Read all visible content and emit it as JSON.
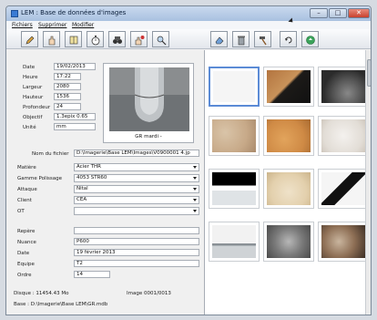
{
  "window": {
    "title": "LEM : Base de données d'images"
  },
  "menu": [
    "Fichiers",
    "Supprimer",
    "Modifier"
  ],
  "toolbar": {
    "left_icons": [
      "pencil-icon",
      "hand-icon",
      "book-icon",
      "stopwatch-icon",
      "binoculars-icon",
      "add-hand-icon",
      "hand-lens-icon"
    ],
    "right_icons": [
      "eraser-icon",
      "trash-icon",
      "hammer-icon",
      "rotate-icon",
      "recycle-icon"
    ]
  },
  "details": {
    "date_label": "Date",
    "date": "19/02/2013",
    "heure_label": "Heure",
    "heure": "17:22",
    "largeur_label": "Largeur",
    "largeur": "2080",
    "hauteur_label": "Hauteur",
    "hauteur": "1536",
    "profondeur_label": "Profondeur",
    "profondeur": "24",
    "objectif_label": "Objectif",
    "objectif": "1.3epix 0.65",
    "unite_label": "Unité",
    "unite": "mm"
  },
  "preview": {
    "caption": "GR mardi -"
  },
  "file": {
    "label": "Nom du fichier",
    "value": "D:\\Imagerie\\Base LEM\\Images\\V0900001 4.jp"
  },
  "fields": [
    {
      "label": "Matière",
      "value": "Acier THR"
    },
    {
      "label": "Gamme Polissage",
      "value": "4053 STR60"
    },
    {
      "label": "Attaque",
      "value": "Nital"
    },
    {
      "label": "Client",
      "value": "CEA"
    },
    {
      "label": "OT",
      "value": ""
    }
  ],
  "extra": [
    {
      "label": "Repère",
      "value": ""
    },
    {
      "label": "Nuance",
      "value": "P600"
    },
    {
      "label": "Date",
      "value": "19 février 2013"
    },
    {
      "label": "Equipe",
      "value": "T2"
    },
    {
      "label": "Ordre",
      "value": "14"
    }
  ],
  "status": {
    "disk": "Disque : 11454.43 Mo",
    "image": "Image 0001/0013",
    "base": "Base : D:\\Imagerie\\Base LEM\\GR.mdb"
  },
  "colors": {
    "accent": "#5b8bd6",
    "title_bar": "#b8cde6"
  }
}
